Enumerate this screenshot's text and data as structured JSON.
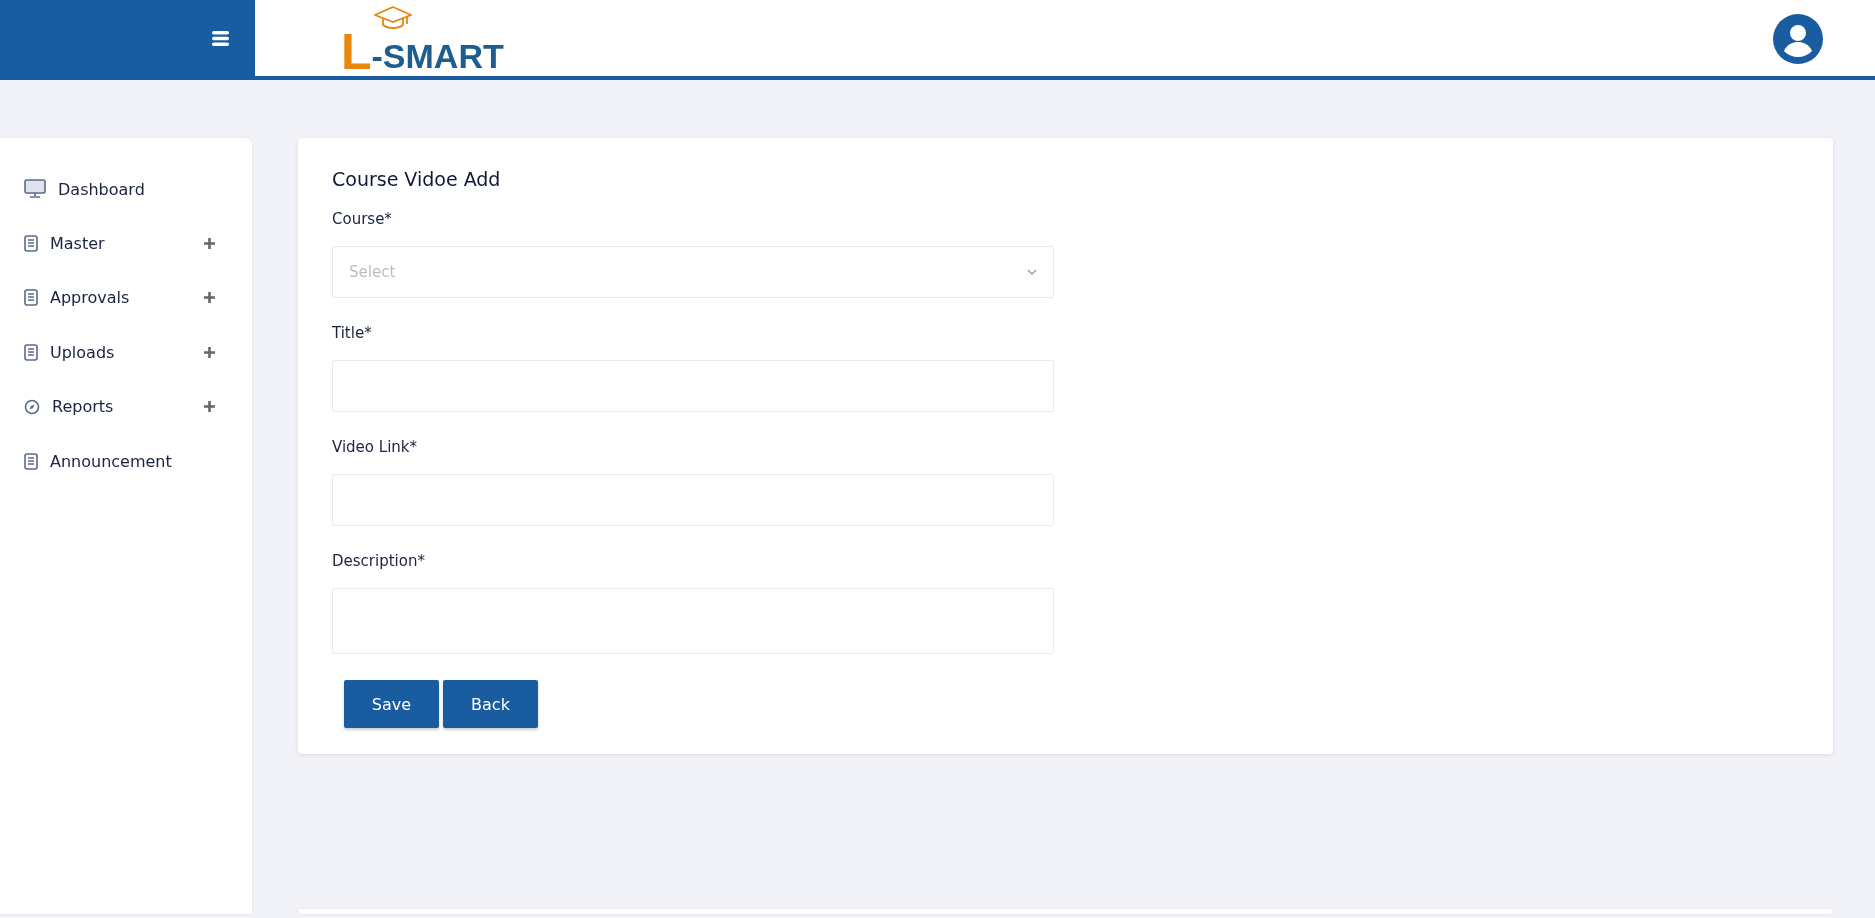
{
  "header": {
    "logo": {
      "initial": "L",
      "rest": "-SMART"
    }
  },
  "sidebar": {
    "items": [
      {
        "label": "Dashboard",
        "has_submenu": false
      },
      {
        "label": "Master",
        "has_submenu": true
      },
      {
        "label": "Approvals",
        "has_submenu": true
      },
      {
        "label": "Uploads",
        "has_submenu": true
      },
      {
        "label": "Reports",
        "has_submenu": true
      },
      {
        "label": "Announcement",
        "has_submenu": false
      }
    ]
  },
  "form": {
    "title": "Course Vidoe Add",
    "fields": [
      {
        "label": "Course*",
        "kind": "select",
        "placeholder": "Select"
      },
      {
        "label": "Title*",
        "kind": "text"
      },
      {
        "label": "Video Link*",
        "kind": "text"
      },
      {
        "label": "Description*",
        "kind": "textarea"
      }
    ],
    "buttons": [
      "Save",
      "Back"
    ]
  }
}
